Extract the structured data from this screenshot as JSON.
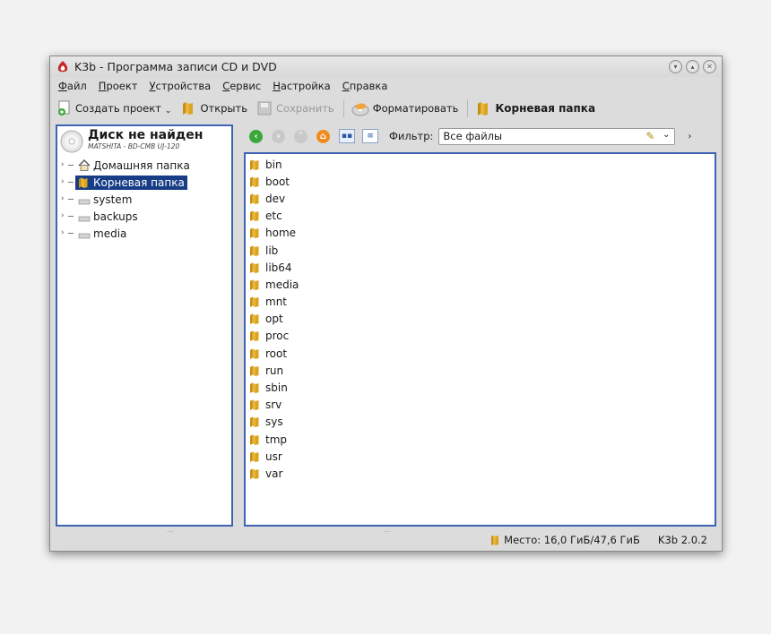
{
  "window": {
    "title": "K3b - Программа записи CD и DVD"
  },
  "menubar": [
    "Файл",
    "Проект",
    "Устройства",
    "Сервис",
    "Настройка",
    "Справка"
  ],
  "toolbar": {
    "new_project": "Создать проект",
    "open": "Открыть",
    "save": "Сохранить",
    "format": "Форматировать",
    "current_folder": "Корневая папка"
  },
  "device": {
    "title": "Диск не найден",
    "subtitle": "MATSHITA - BD-CMB UJ-120"
  },
  "tree": [
    {
      "label": "Домашняя папка",
      "icon": "home-icon",
      "selected": false
    },
    {
      "label": "Корневая папка",
      "icon": "folder-icon",
      "selected": true
    },
    {
      "label": "system",
      "icon": "drive-icon",
      "selected": false
    },
    {
      "label": "backups",
      "icon": "drive-icon",
      "selected": false
    },
    {
      "label": "media",
      "icon": "drive-icon",
      "selected": false
    }
  ],
  "filter": {
    "label": "Фильтр:",
    "value": "Все файлы"
  },
  "files": [
    "bin",
    "boot",
    "dev",
    "etc",
    "home",
    "lib",
    "lib64",
    "media",
    "mnt",
    "opt",
    "proc",
    "root",
    "run",
    "sbin",
    "srv",
    "sys",
    "tmp",
    "usr",
    "var"
  ],
  "status": {
    "space": "Место: 16,0 ГиБ/47,6 ГиБ",
    "version": "K3b 2.0.2"
  },
  "colors": {
    "selection": "#163d86",
    "focus_border": "#3f64b5",
    "folder": "#d9a521",
    "nav_green": "#3aa83a",
    "nav_orange": "#f08a1c"
  }
}
